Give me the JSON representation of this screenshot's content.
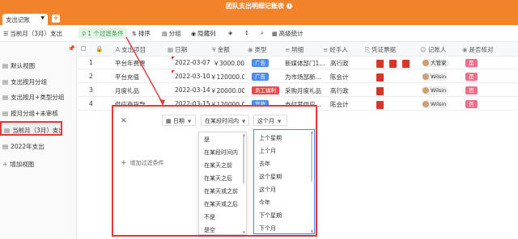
{
  "window": {
    "title": "团队支出明细记账表",
    "info_icon": "info-icon"
  },
  "tabs": {
    "active_label": "支出记账",
    "add_label": "+"
  },
  "toolbar": {
    "view_label": "当前月（3月）支出",
    "filter_label": "1 个过滤条件",
    "sort_label": "排序",
    "group_label": "分组",
    "hide_label": "隐藏列",
    "height_label": "",
    "advanced_label": "高级统计"
  },
  "sidebar": {
    "items": [
      {
        "label": "默认视图"
      },
      {
        "label": "支出按月分组"
      },
      {
        "label": "支出按月+类型分组"
      },
      {
        "label": "按月分组+未审核"
      },
      {
        "label": "当前月（3月）支出"
      },
      {
        "label": "2022年支出"
      },
      {
        "label": "增加视图"
      }
    ]
  },
  "table": {
    "headers": [
      "支出项目",
      "日期",
      "金额",
      "类型",
      "明细",
      "经手人",
      "凭证票据",
      "记账人",
      "是否核对"
    ],
    "rows": [
      {
        "num": "1",
        "item": "平台年费费",
        "date": "2022-03-07",
        "amount": "￥3000.00",
        "type": "广告",
        "detail": "新媒体部门1...",
        "handler": "高行政",
        "pdfs": 3,
        "recorder": "大管家",
        "checked": "是"
      },
      {
        "num": "2",
        "item": "平台充值",
        "date": "2022-03-10",
        "amount": "￥120000.00",
        "type": "广告",
        "detail": "为市场部新...",
        "handler": "陈会计",
        "pdfs": 1,
        "recorder": "Wilsin",
        "checked": "是"
      },
      {
        "num": "3",
        "item": "月度礼品",
        "date": "2022-03-14",
        "amount": "￥20000.00",
        "type": "员工福利",
        "detail": "采购月度礼品",
        "handler": "高行政",
        "pdfs": 1,
        "recorder": "Wilsin",
        "checked": "否"
      },
      {
        "num": "4",
        "item": "供应商货款",
        "date": "2022-03-15",
        "amount": "￥120000.00",
        "type": "货款",
        "detail": "支付某供应...",
        "handler": "陈会计",
        "pdfs": 1,
        "recorder": "Wilsin",
        "checked": "否"
      }
    ]
  },
  "filter": {
    "field_label": "日期",
    "operator_label": "在某段时间内",
    "value_label": "这个月",
    "add_label": "增加过滤条件",
    "operator_options": [
      "是",
      "在某段时间内",
      "在某天之前",
      "在某天之后",
      "在某天或之前",
      "在某天或之后",
      "不是",
      "是空"
    ],
    "value_options": [
      "上个星期",
      "上个月",
      "去年",
      "这个星期",
      "这个月",
      "今年",
      "下个星期",
      "下个月"
    ]
  },
  "colors": {
    "accent": "#f2832b",
    "annotation": "#e5383b",
    "filter_green": "#2e9a47"
  }
}
